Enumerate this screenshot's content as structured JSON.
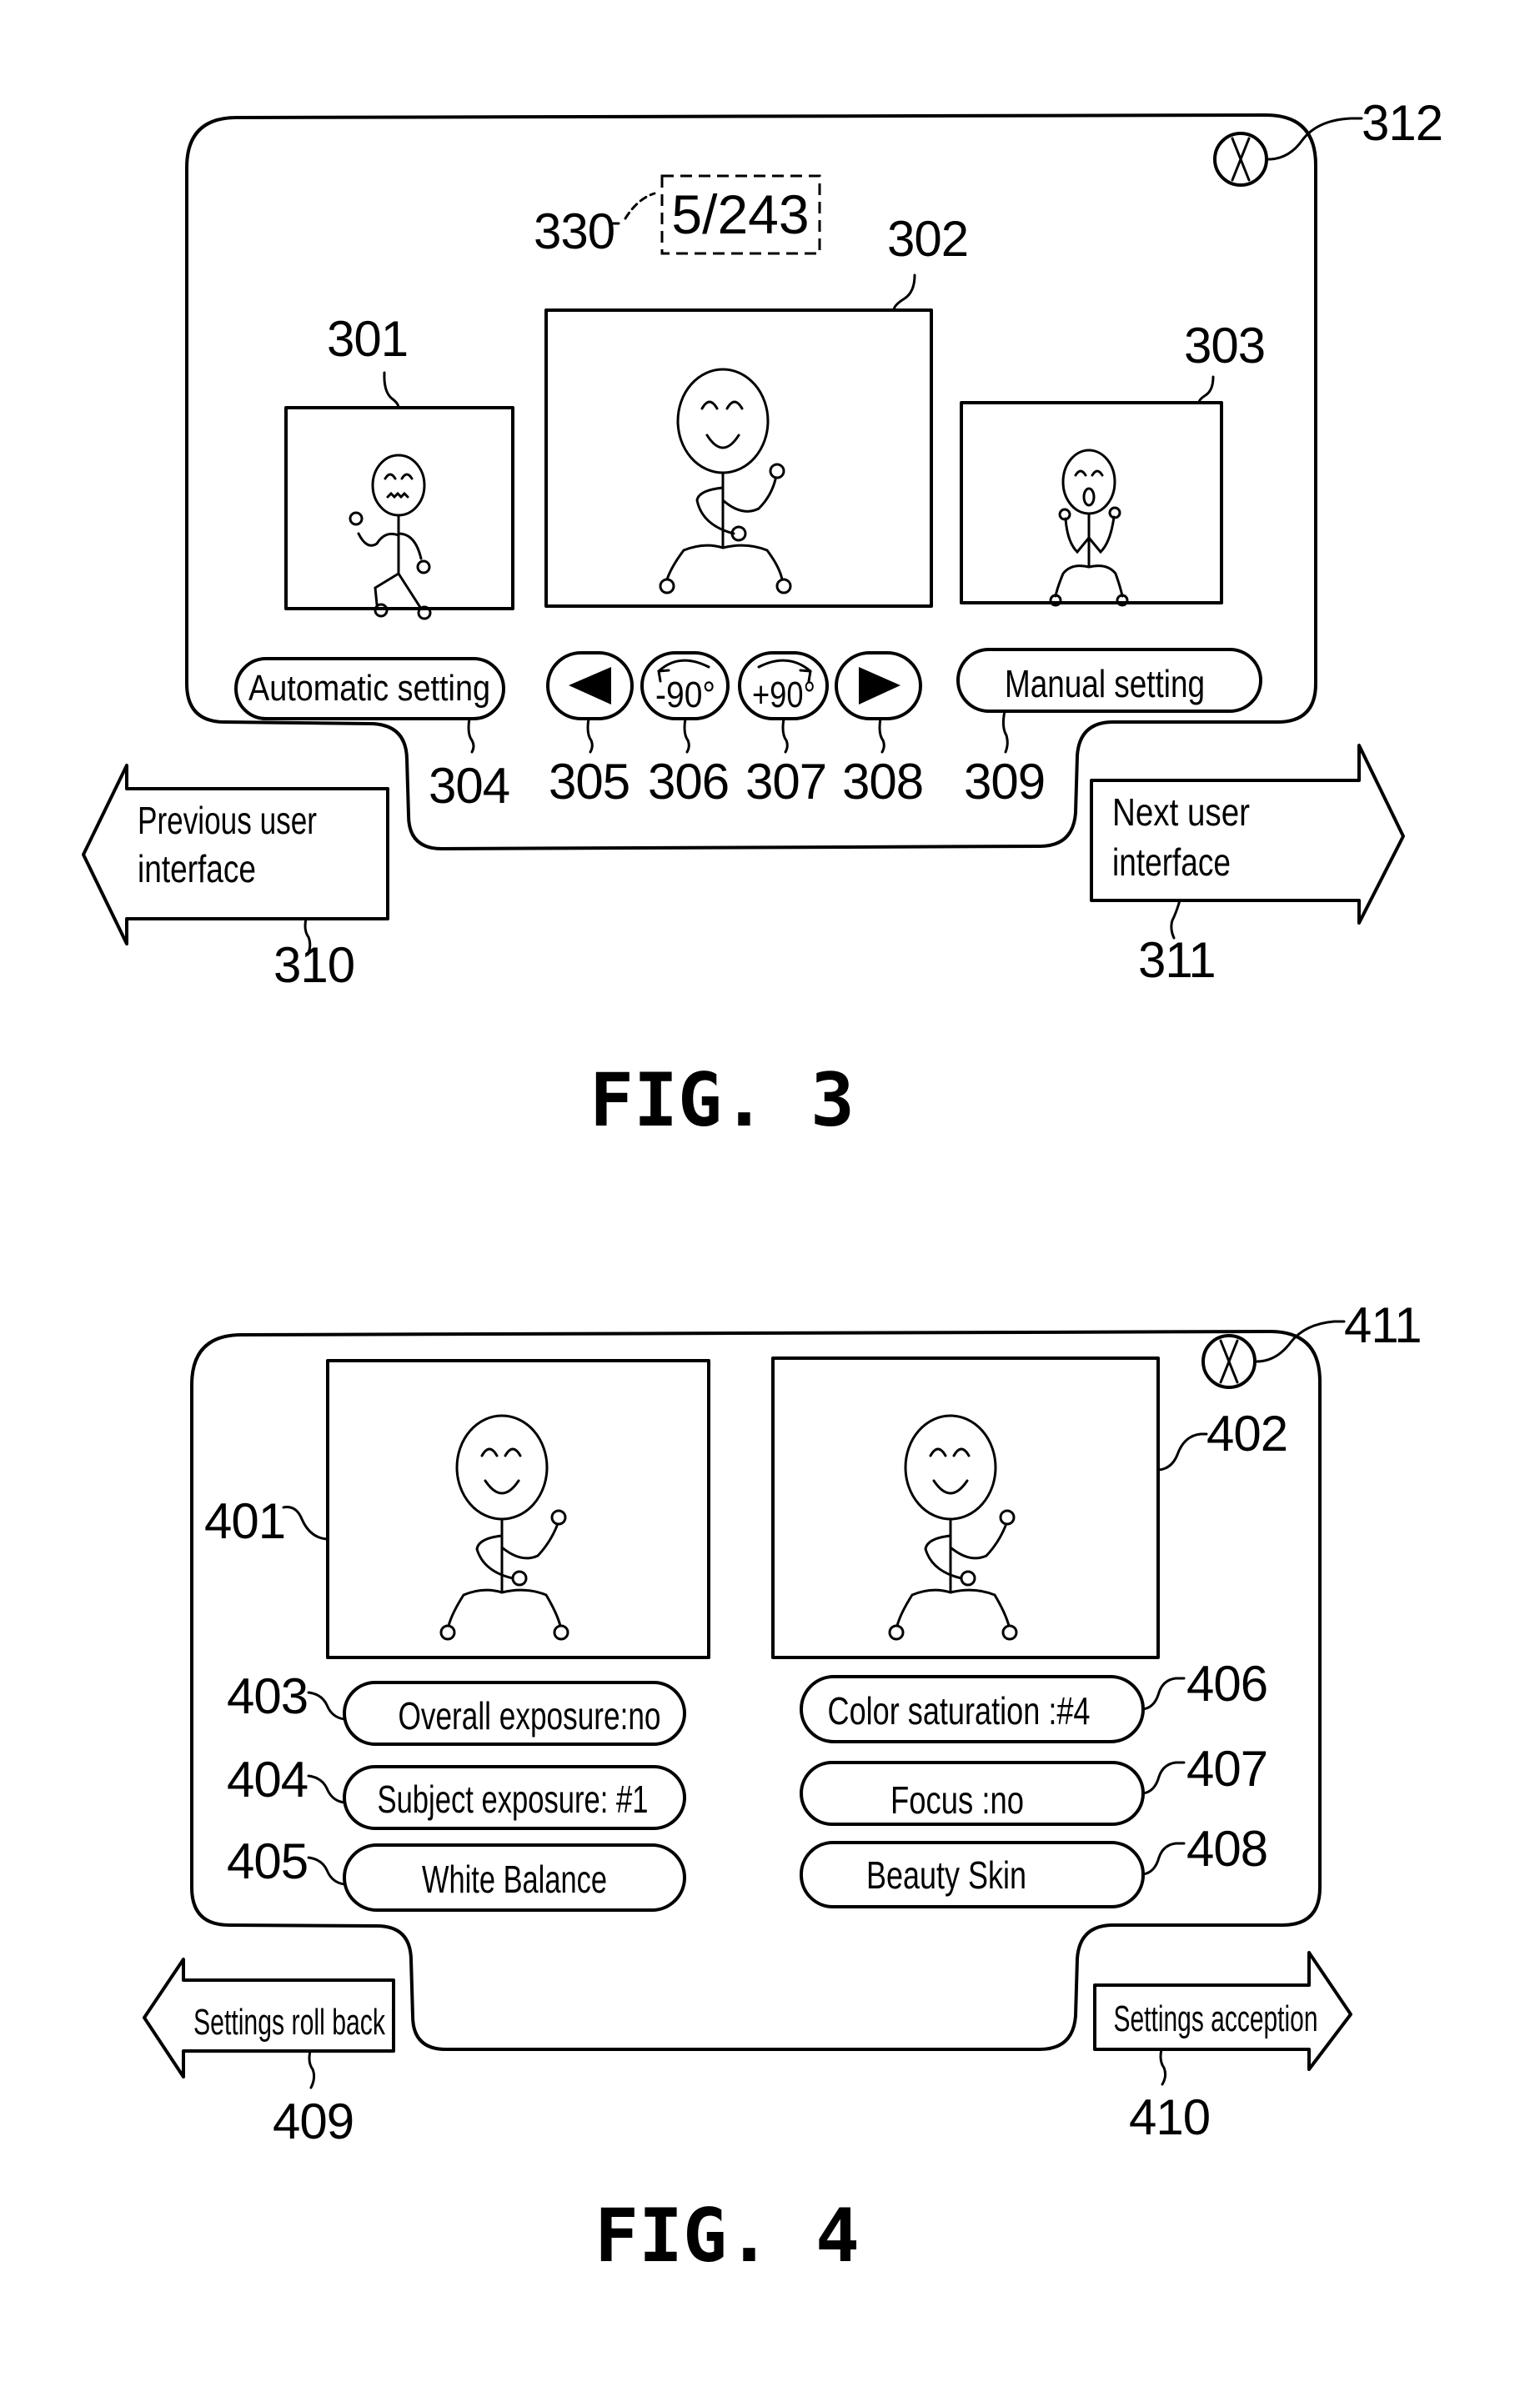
{
  "figures": [
    {
      "caption": "FIG. 3",
      "counter": {
        "ref": "330",
        "text": "5/243"
      },
      "close_button": {
        "ref": "312",
        "icon": "close-circle-icon",
        "glyph": "X"
      },
      "thumbnails": [
        {
          "ref": "301",
          "role": "previous-image",
          "expression": "worried"
        },
        {
          "ref": "302",
          "role": "current-image",
          "expression": "smiling"
        },
        {
          "ref": "303",
          "role": "next-image",
          "expression": "surprised"
        }
      ],
      "controls": [
        {
          "ref": "304",
          "label": "Automatic setting"
        },
        {
          "ref": "305",
          "label": "",
          "icon": "triangle-left-icon"
        },
        {
          "ref": "306",
          "label": "-90°",
          "icon": "rotate-ccw-icon"
        },
        {
          "ref": "307",
          "label": "+90°",
          "icon": "rotate-cw-icon"
        },
        {
          "ref": "308",
          "label": "",
          "icon": "triangle-right-icon"
        },
        {
          "ref": "309",
          "label": "Manual setting"
        }
      ],
      "nav": {
        "previous": {
          "ref": "310",
          "line1": "Previous user",
          "line2": "interface"
        },
        "next": {
          "ref": "311",
          "line1": "Next user",
          "line2": "interface"
        }
      }
    },
    {
      "caption": "FIG. 4",
      "close_button": {
        "ref": "411",
        "icon": "close-circle-icon",
        "glyph": "X"
      },
      "previews": [
        {
          "ref": "401",
          "role": "before-settings"
        },
        {
          "ref": "402",
          "role": "after-settings"
        }
      ],
      "settings_left": [
        {
          "ref": "403",
          "label": "Overall exposure:no"
        },
        {
          "ref": "404",
          "label": "Subject exposure: #1"
        },
        {
          "ref": "405",
          "label": "White Balance"
        }
      ],
      "settings_right": [
        {
          "ref": "406",
          "label": "Color saturation :#4"
        },
        {
          "ref": "407",
          "label": "Focus :no"
        },
        {
          "ref": "408",
          "label": "Beauty Skin"
        }
      ],
      "nav": {
        "rollback": {
          "ref": "409",
          "label": "Settings roll back"
        },
        "accept": {
          "ref": "410",
          "label": "Settings acception"
        }
      }
    }
  ]
}
